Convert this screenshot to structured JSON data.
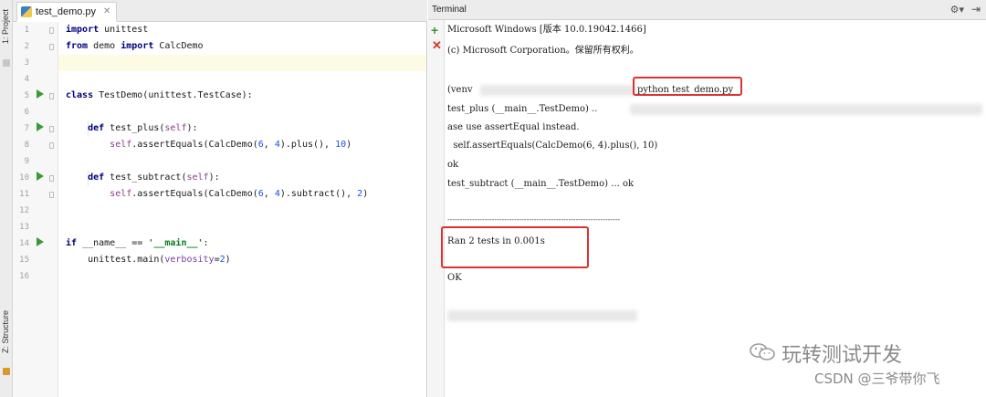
{
  "left_strip": {
    "project_label": "1: Project",
    "structure_label": "Z: Structure"
  },
  "editor": {
    "tab_label": "test_demo.py",
    "line_numbers": [
      "1",
      "2",
      "3",
      "4",
      "5",
      "6",
      "7",
      "8",
      "9",
      "10",
      "11",
      "12",
      "13",
      "14",
      "15",
      "16"
    ]
  },
  "terminal": {
    "title": "Terminal",
    "lines": {
      "l1": "Microsoft Windows [版本 10.0.19042.1466]",
      "l2": "(c) Microsoft Corporation。保留所有权利。",
      "l3_prefix": "(venv",
      "l3_cmd": "python test_demo.py",
      "l4": "test_plus (__main__.TestDemo) ..",
      "l5": "ase use assertEqual instead.",
      "l6": "  self.assertEquals(CalcDemo(6, 4).plus(), 10)",
      "l7": "ok",
      "l8": "test_subtract (__main__.TestDemo) ... ok",
      "l9": "----------------------------------------------------------------------",
      "l10": "Ran 2 tests in 0.001s",
      "l11": "OK"
    }
  },
  "watermark": {
    "line1": "玩转测试开发",
    "line2": "CSDN @三爷带你飞"
  },
  "colors": {
    "highlight_box": "#e03030",
    "run_marker": "#3a9a3a"
  }
}
